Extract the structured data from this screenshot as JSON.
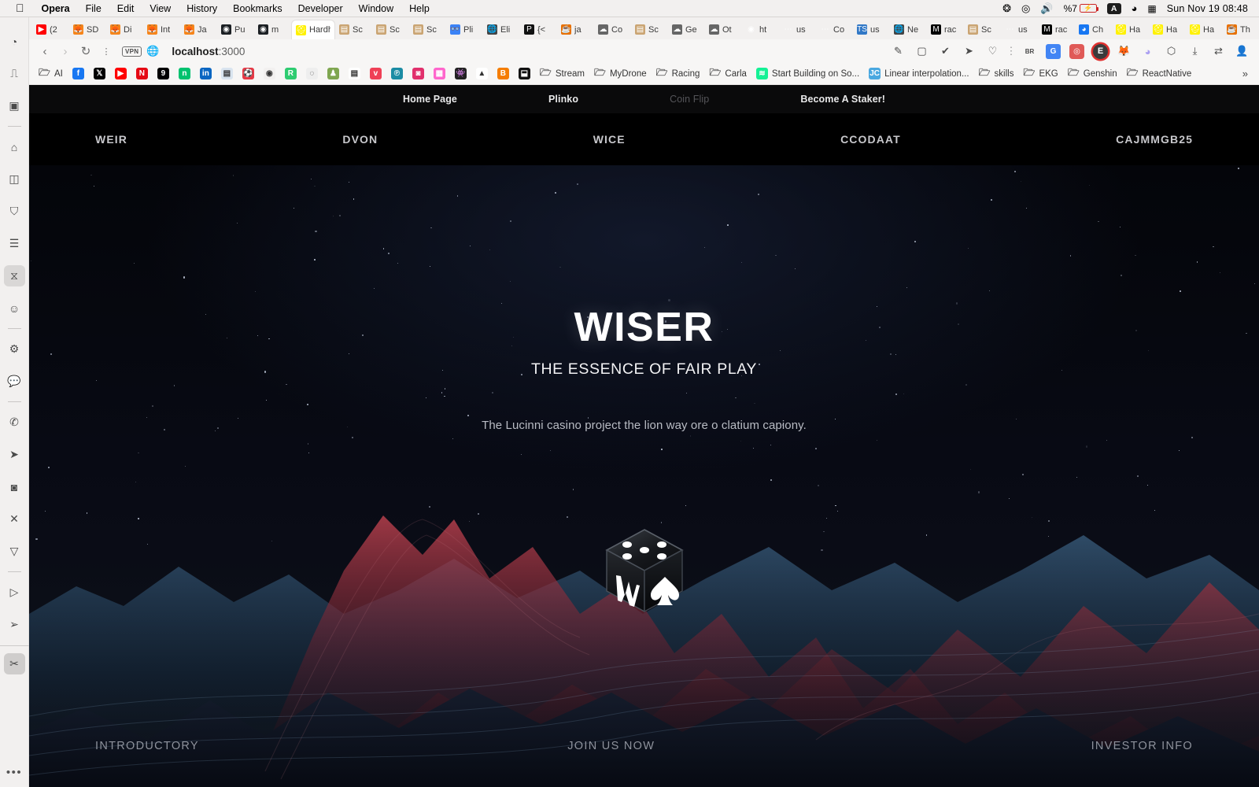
{
  "os_menubar": {
    "apple_icon": "apple-icon",
    "items": [
      {
        "label": "Opera",
        "bold": true
      },
      {
        "label": "File",
        "bold": false
      },
      {
        "label": "Edit",
        "bold": false
      },
      {
        "label": "View",
        "bold": false
      },
      {
        "label": "History",
        "bold": false
      },
      {
        "label": "Bookmarks",
        "bold": false
      },
      {
        "label": "Developer",
        "bold": false
      },
      {
        "label": "Window",
        "bold": false
      },
      {
        "label": "Help",
        "bold": false
      }
    ],
    "status": {
      "bluetooth_icon": "bluetooth-icon",
      "playback_icon": "play-circle-icon",
      "volume_icon": "speaker-icon",
      "battery_percent": "%7",
      "battery_icon": "battery-charging-icon",
      "input_source": "A",
      "wifi_icon": "wifi-icon",
      "control_center_icon": "control-center-icon",
      "clock": "Sun Nov 19  08:48"
    }
  },
  "browser": {
    "sidebar": {
      "items": [
        {
          "name": "speed-dial-icon",
          "glyph": "◔"
        },
        {
          "name": "workspace-icon",
          "glyph": "⎍"
        },
        {
          "name": "messenger-icon",
          "glyph": "▣"
        },
        {
          "name": "separator",
          "glyph": ""
        },
        {
          "name": "home-icon",
          "glyph": "⌂"
        },
        {
          "name": "reading-list-icon",
          "glyph": "◫"
        },
        {
          "name": "toolbox-icon",
          "glyph": "⛉"
        },
        {
          "name": "tab-list-icon",
          "glyph": "☰"
        },
        {
          "name": "hourglass-icon",
          "glyph": "⧖",
          "active": true
        },
        {
          "name": "emoji-icon",
          "glyph": "☺"
        },
        {
          "name": "separator",
          "glyph": ""
        },
        {
          "name": "settings-icon",
          "glyph": "⚙"
        },
        {
          "name": "cs-chat-icon",
          "glyph": "💬"
        },
        {
          "name": "separator",
          "glyph": ""
        },
        {
          "name": "whatsapp-icon",
          "glyph": "✆"
        },
        {
          "name": "telegram-icon",
          "glyph": "➤"
        },
        {
          "name": "instagram-icon",
          "glyph": "◙"
        },
        {
          "name": "x-twitter-icon",
          "glyph": "✕"
        },
        {
          "name": "vk-icon",
          "glyph": "▽"
        },
        {
          "name": "separator",
          "glyph": ""
        },
        {
          "name": "player-icon",
          "glyph": "▷"
        },
        {
          "name": "send-icon",
          "glyph": "➢"
        },
        {
          "name": "rule",
          "glyph": ""
        },
        {
          "name": "snip-tool-icon",
          "glyph": "✂",
          "pinned": true
        }
      ],
      "overflow_label": "•••"
    },
    "tabs": [
      {
        "label": "(2",
        "favicon": "youtube-icon",
        "color": "#f00",
        "glyph": "▶"
      },
      {
        "label": "SD",
        "favicon": "metamask-icon",
        "color": "#f6851b",
        "glyph": "🦊"
      },
      {
        "label": "Di",
        "favicon": "metamask-icon",
        "color": "#f6851b",
        "glyph": "🦊"
      },
      {
        "label": "Int",
        "favicon": "metamask-icon",
        "color": "#f6851b",
        "glyph": "🦊"
      },
      {
        "label": "Ja",
        "favicon": "metamask-icon",
        "color": "#f6851b",
        "glyph": "🦊"
      },
      {
        "label": "Pu",
        "favicon": "github-icon",
        "color": "#1b1f23",
        "glyph": "◉"
      },
      {
        "label": "m",
        "favicon": "github-icon",
        "color": "#1b1f23",
        "glyph": "◉"
      },
      {
        "label": "Hardh",
        "favicon": "hardhat-icon",
        "color": "#fff100",
        "glyph": "⛑",
        "active": true
      },
      {
        "label": "Sc",
        "favicon": "scroll-icon",
        "color": "#caa472",
        "glyph": "▤"
      },
      {
        "label": "Sc",
        "favicon": "scroll-icon",
        "color": "#caa472",
        "glyph": "▤"
      },
      {
        "label": "Sc",
        "favicon": "scroll-icon",
        "color": "#caa472",
        "glyph": "▤"
      },
      {
        "label": "Pli",
        "favicon": "binoculars-icon",
        "color": "#3b82f6",
        "glyph": "👓"
      },
      {
        "label": "Eli",
        "favicon": "globe-icon",
        "color": "#444",
        "glyph": "🌐"
      },
      {
        "label": "{<",
        "favicon": "postman-icon",
        "color": "#111",
        "glyph": "P"
      },
      {
        "label": "ja",
        "favicon": "java-icon",
        "color": "#e76f00",
        "glyph": "☕"
      },
      {
        "label": "Co",
        "favicon": "cloud-icon",
        "color": "#666",
        "glyph": "☁"
      },
      {
        "label": "Sc",
        "favicon": "scroll-icon",
        "color": "#caa472",
        "glyph": "▤"
      },
      {
        "label": "Ge",
        "favicon": "cloud-icon",
        "color": "#666",
        "glyph": "☁"
      },
      {
        "label": "Ot",
        "favicon": "cloud-icon",
        "color": "#666",
        "glyph": "☁"
      },
      {
        "label": "ht",
        "favicon": "github-icon",
        "color": "#ddd",
        "glyph": "◉"
      },
      {
        "label": "us",
        "favicon": "docs-icon",
        "color": "#bbb",
        "glyph": "⋯"
      },
      {
        "label": "Co",
        "favicon": "docs-icon",
        "color": "#bbb",
        "glyph": "⋯"
      },
      {
        "label": "us",
        "favicon": "typescript-icon",
        "color": "#3178c6",
        "glyph": "TS"
      },
      {
        "label": "Ne",
        "favicon": "globe-icon",
        "color": "#444",
        "glyph": "🌐"
      },
      {
        "label": "rac",
        "favicon": "medium-icon",
        "color": "#000",
        "glyph": "M"
      },
      {
        "label": "Sc",
        "favicon": "scroll-icon",
        "color": "#caa472",
        "glyph": "▤"
      },
      {
        "label": "us",
        "favicon": "docs-icon",
        "color": "#bbb",
        "glyph": "⋯"
      },
      {
        "label": "rac",
        "favicon": "medium-icon",
        "color": "#000",
        "glyph": "M"
      },
      {
        "label": "Ch",
        "favicon": "chat-icon",
        "color": "#1877f2",
        "glyph": "◕"
      },
      {
        "label": "Ha",
        "favicon": "hardhat-icon",
        "color": "#fff100",
        "glyph": "⛑"
      },
      {
        "label": "Ha",
        "favicon": "hardhat-icon",
        "color": "#fff100",
        "glyph": "⛑"
      },
      {
        "label": "Ha",
        "favicon": "hardhat-icon",
        "color": "#fff100",
        "glyph": "⛑"
      },
      {
        "label": "Th",
        "favicon": "java-icon",
        "color": "#e76f00",
        "glyph": "☕"
      }
    ],
    "tab_new_label": "+",
    "tab_search_icon": "search-icon",
    "address_bar": {
      "back_icon": "back-arrow-icon",
      "forward_icon": "forward-arrow-icon",
      "reload_icon": "reload-icon",
      "menu_icon": "kebab-menu-icon",
      "vpn_badge": "VPN",
      "site_icon": "globe-icon",
      "url": "localhost:3000",
      "url_host": "localhost",
      "url_port": ":3000",
      "right_icons": [
        {
          "name": "edit-page-icon",
          "glyph": "✎"
        },
        {
          "name": "snapshot-icon",
          "glyph": "▢"
        },
        {
          "name": "shield-icon",
          "glyph": "✔"
        },
        {
          "name": "send-icon",
          "glyph": "➤"
        },
        {
          "name": "heart-icon",
          "glyph": "♡"
        },
        {
          "name": "kebab-menu-icon",
          "glyph": "⋮"
        },
        {
          "name": "brave-rewards-icon",
          "glyph": "BR"
        },
        {
          "name": "google-translate-icon",
          "glyph": "G"
        },
        {
          "name": "extension-red-icon",
          "glyph": "◎"
        },
        {
          "name": "extension-e-icon",
          "glyph": "E"
        },
        {
          "name": "metamask-icon",
          "glyph": "🦊"
        },
        {
          "name": "phantom-icon",
          "glyph": "◕"
        },
        {
          "name": "package-icon",
          "glyph": "⬡"
        },
        {
          "name": "downloads-icon",
          "glyph": "⤓"
        },
        {
          "name": "easy-setup-icon",
          "glyph": "⇄"
        },
        {
          "name": "profile-icon",
          "glyph": "👤"
        }
      ]
    },
    "bookmarks": [
      {
        "label": "AI",
        "icon": "folder-icon",
        "type": "folder"
      },
      {
        "label": "",
        "icon": "facebook-icon",
        "color": "#1877f2",
        "glyph": "f"
      },
      {
        "label": "",
        "icon": "x-twitter-icon",
        "color": "#000",
        "glyph": "𝕏"
      },
      {
        "label": "",
        "icon": "youtube-icon",
        "color": "#ff0000",
        "glyph": "▶"
      },
      {
        "label": "",
        "icon": "netflix-icon",
        "color": "#e50914",
        "glyph": "N"
      },
      {
        "label": "",
        "icon": "9gag-icon",
        "color": "#000",
        "glyph": "9"
      },
      {
        "label": "",
        "icon": "hacker-news-icon",
        "color": "#00c26f",
        "glyph": "n"
      },
      {
        "label": "",
        "icon": "linkedin-icon",
        "color": "#0a66c2",
        "glyph": "in"
      },
      {
        "label": "",
        "icon": "notes-icon",
        "color": "#d9e4ef",
        "glyph": "▤"
      },
      {
        "label": "",
        "icon": "sports-icon",
        "color": "#e63946",
        "glyph": "⚽"
      },
      {
        "label": "",
        "icon": "github-icon",
        "color": "#f2f0ef",
        "glyph": "◉"
      },
      {
        "label": "",
        "icon": "reddit-icon",
        "color": "#2ecc71",
        "glyph": "R"
      },
      {
        "label": "",
        "icon": "opera-gx-icon",
        "color": "#eee",
        "glyph": "◌"
      },
      {
        "label": "",
        "icon": "chess-icon",
        "color": "#7fa650",
        "glyph": "♟"
      },
      {
        "label": "",
        "icon": "document-icon",
        "color": "#fff",
        "glyph": "▤"
      },
      {
        "label": "",
        "icon": "pocket-icon",
        "color": "#ef4056",
        "glyph": "v"
      },
      {
        "label": "",
        "icon": "patreon-icon",
        "color": "#1b8ca4",
        "glyph": "℗"
      },
      {
        "label": "",
        "icon": "instagram-icon",
        "color": "#e1306c",
        "glyph": "◙"
      },
      {
        "label": "",
        "icon": "color-grid-icon",
        "color": "#f6c",
        "glyph": "▦"
      },
      {
        "label": "",
        "icon": "alien-icon",
        "color": "#222",
        "glyph": "👾"
      },
      {
        "label": "",
        "icon": "google-drive-icon",
        "color": "#fff",
        "glyph": "▲"
      },
      {
        "label": "",
        "icon": "blogger-icon",
        "color": "#f57d00",
        "glyph": "B"
      },
      {
        "label": "",
        "icon": "inbox-icon",
        "color": "#111",
        "glyph": "⬓"
      },
      {
        "label": "Stream",
        "icon": "folder-icon",
        "type": "folder"
      },
      {
        "label": "MyDrone",
        "icon": "folder-icon",
        "type": "folder"
      },
      {
        "label": "Racing",
        "icon": "folder-icon",
        "type": "folder"
      },
      {
        "label": "Carla",
        "icon": "folder-icon",
        "type": "folder"
      },
      {
        "label": "Start Building on So...",
        "icon": "solana-icon",
        "color": "#14f195",
        "glyph": "≋"
      },
      {
        "label": "Linear interpolation...",
        "icon": "jc-icon",
        "color": "#4aa8e0",
        "glyph": "JC"
      },
      {
        "label": "skills",
        "icon": "folder-icon",
        "type": "folder"
      },
      {
        "label": "EKG",
        "icon": "folder-icon",
        "type": "folder"
      },
      {
        "label": "Genshin",
        "icon": "folder-icon",
        "type": "folder"
      },
      {
        "label": "ReactNative",
        "icon": "folder-icon",
        "type": "folder"
      }
    ],
    "bookmarks_overflow": "»"
  },
  "page": {
    "nav": [
      {
        "label": "Home Page",
        "dim": false
      },
      {
        "label": "Plinko",
        "dim": false
      },
      {
        "label": "Coin Flip",
        "dim": true
      },
      {
        "label": "Become A Staker!",
        "dim": false
      }
    ],
    "ticker": [
      "WEIR",
      "DVON",
      "WICE",
      "CCODAAT",
      "CAJMMGB25"
    ],
    "hero": {
      "title": "WISER",
      "subtitle": "THE ESSENCE OF FAIR PLAY",
      "description": "The Lucinni casino project the lion way ore o clatium capiony.",
      "logo_icon": "dice-logo-icon"
    },
    "bottom_links": [
      "INTRODUCTORY",
      "JOIN US NOW",
      "INVESTOR INFO"
    ],
    "colors": {
      "page_bg": "#05060a",
      "nav_bg": "#0a0a0b",
      "ticker_bg": "#000000",
      "title": "#ffffff",
      "description": "#b9bcc4",
      "bottom_link": "#8e929c",
      "mountain_red": "#8e2430",
      "mountain_blue": "#2a4a6e"
    }
  }
}
